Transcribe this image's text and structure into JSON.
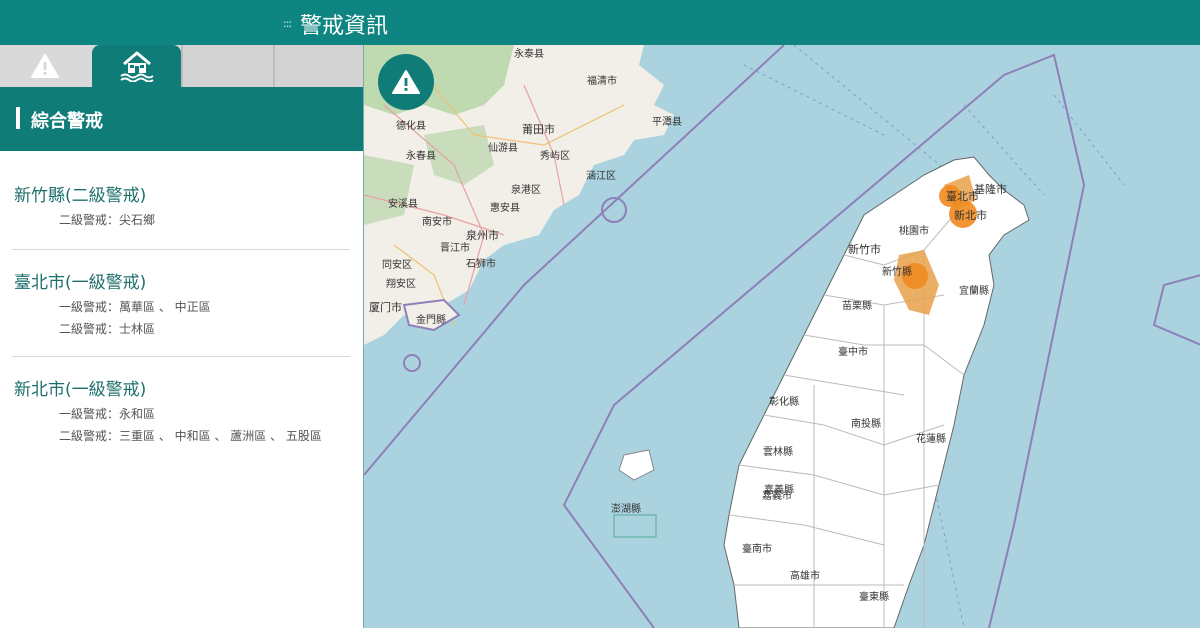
{
  "header": {
    "dots": ":::",
    "title": "警戒資訊"
  },
  "tabs": [
    {
      "name": "alert",
      "icon": "warning-icon"
    },
    {
      "name": "flood",
      "icon": "house-flood-icon",
      "active": true
    },
    {
      "name": "empty-1"
    },
    {
      "name": "empty-2"
    }
  ],
  "section": {
    "title": "綜合警戒"
  },
  "alerts": [
    {
      "region": "新竹縣(二級警戒)",
      "lines": [
        "二級警戒：尖石鄉"
      ]
    },
    {
      "region": "臺北市(一級警戒)",
      "lines": [
        "一級警戒：萬華區 、 中正區",
        "二級警戒：士林區"
      ]
    },
    {
      "region": "新北市(一級警戒)",
      "lines": [
        "一級警戒：永和區",
        "二級警戒：三重區 、 中和區 、 蘆洲區 、 五股區"
      ]
    }
  ],
  "map": {
    "colors": {
      "sea": "#aad3df",
      "land_mainland": "#f2efe9",
      "green": "#add19e",
      "taiwan": "#ffffff",
      "warning": "#e8a04a",
      "warning_marker": "#ef8a1f",
      "boundary": "#8e7fb8"
    },
    "mainland_labels": [
      "永泰县",
      "福清市",
      "平潭县",
      "德化县",
      "莆田市",
      "仙游县",
      "永春县",
      "秀屿区",
      "涵江区",
      "泉港区",
      "安溪县",
      "惠安县",
      "南安市",
      "泉州市",
      "晋江市",
      "石狮市",
      "同安区",
      "翔安区",
      "厦门市",
      "金門縣"
    ],
    "taiwan_labels": [
      "臺北市",
      "基隆市",
      "新北市",
      "桃園市",
      "新竹市",
      "新竹縣",
      "宜蘭縣",
      "苗栗縣",
      "臺中市",
      "彰化縣",
      "南投縣",
      "花蓮縣",
      "雲林縣",
      "嘉義縣",
      "嘉義市",
      "臺南市",
      "高雄市",
      "臺東縣",
      "澎湖縣"
    ]
  }
}
